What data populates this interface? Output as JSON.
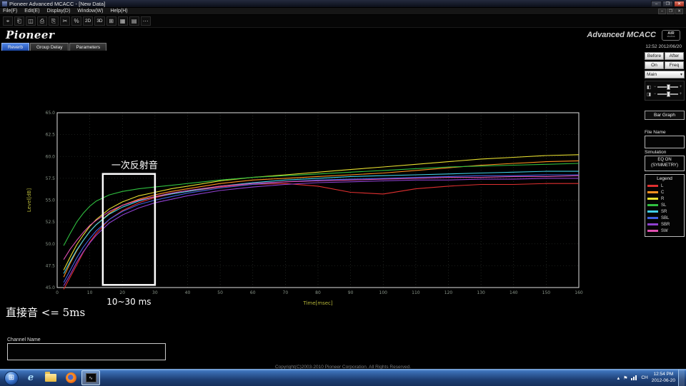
{
  "window": {
    "title": "Pioneer Advanced MCACC - [New Data]",
    "minimize": "–",
    "maximize": "❐",
    "close": "✕"
  },
  "menubar": {
    "items": [
      "File(F)",
      "Edit(E)",
      "Display(D)",
      "Window(W)",
      "Help(H)"
    ],
    "minimize": "–",
    "restore": "❐",
    "close": "✕"
  },
  "toolbar": {
    "items": [
      {
        "name": "select-icon",
        "glyph": "⌖"
      },
      {
        "name": "open-file-icon",
        "glyph": "⎗"
      },
      {
        "name": "save-icon",
        "glyph": "◫"
      },
      {
        "name": "print-icon",
        "glyph": "⎙"
      },
      {
        "name": "copy-icon",
        "glyph": "⎘"
      },
      {
        "name": "cut-icon",
        "glyph": "✂"
      },
      {
        "name": "percent-icon",
        "glyph": "%"
      },
      {
        "name": "view-2d-button",
        "label": "2D"
      },
      {
        "name": "view-3d-button",
        "label": "3D"
      },
      {
        "name": "grid-view-icon",
        "glyph": "⊞"
      },
      {
        "name": "table-view-icon",
        "glyph": "▦"
      },
      {
        "name": "list-view-icon",
        "glyph": "▤"
      },
      {
        "name": "more-tools-icon",
        "glyph": "⋯"
      }
    ]
  },
  "header": {
    "logo": "Pioneer",
    "product": "Advanced MCACC",
    "badge_top": "AIR",
    "badge_bottom": "studios"
  },
  "tabs": {
    "items": [
      {
        "id": "reverb",
        "label": "Reverb",
        "active": true
      },
      {
        "id": "group-delay",
        "label": "Group Delay",
        "active": false
      },
      {
        "id": "parameters",
        "label": "Parameters",
        "active": false
      }
    ],
    "timestamp": "12:52 2012/06/20"
  },
  "right_panel": {
    "before": "Before",
    "after": "After",
    "on": "On",
    "freq": "Freq",
    "channel_select": "Main",
    "bar_graph": "Bar Graph",
    "file_name_label": "File Name",
    "file_name_value": "",
    "simulation_label": "Simulation",
    "eq_line1": "EQ ON",
    "eq_line2": "(SYMMETRY)",
    "legend_title": "Legend",
    "legend_items": [
      {
        "label": "L",
        "color": "#e03030"
      },
      {
        "label": "C",
        "color": "#ff9020"
      },
      {
        "label": "R",
        "color": "#e8e030"
      },
      {
        "label": "SL",
        "color": "#30c040"
      },
      {
        "label": "SR",
        "color": "#40d0e8"
      },
      {
        "label": "SBL",
        "color": "#4060e0"
      },
      {
        "label": "SBR",
        "color": "#9040d0"
      },
      {
        "label": "SW",
        "color": "#e050b0"
      }
    ]
  },
  "annotations": {
    "first_reflection_label": "一次反射音",
    "range_label": "10~30 ms",
    "direct_sound_label": "直接音 <= 5ms",
    "box_ms": [
      14,
      30
    ],
    "box_db": [
      45.3,
      58.0
    ]
  },
  "chart_data": {
    "type": "line",
    "title": "Reverb characteristics (raw data)",
    "xlabel": "Time[msec]",
    "ylabel": "Level[dB]",
    "xlim": [
      0,
      160
    ],
    "ylim": [
      45,
      65
    ],
    "x_ticks": [
      0,
      10,
      20,
      30,
      40,
      50,
      60,
      70,
      80,
      90,
      100,
      110,
      120,
      130,
      140,
      150,
      160
    ],
    "y_ticks": [
      45.0,
      47.5,
      50.0,
      52.5,
      55.0,
      57.5,
      60.0,
      62.5,
      65.0
    ],
    "x": [
      2,
      4,
      6,
      8,
      10,
      12,
      16,
      20,
      25,
      30,
      35,
      40,
      50,
      60,
      70,
      80,
      90,
      100,
      110,
      120,
      130,
      140,
      150,
      160
    ],
    "series": [
      {
        "name": "L",
        "color": "#e03030",
        "values": [
          44.8,
          46.2,
          47.6,
          49.0,
          50.2,
          51.2,
          52.8,
          53.8,
          54.7,
          55.3,
          55.7,
          56.0,
          56.5,
          56.8,
          56.9,
          56.6,
          55.9,
          55.7,
          56.3,
          56.6,
          56.8,
          56.8,
          56.9,
          56.9
        ]
      },
      {
        "name": "C",
        "color": "#ff9020",
        "values": [
          46.2,
          47.8,
          49.2,
          50.4,
          51.4,
          52.2,
          53.5,
          54.4,
          55.1,
          55.6,
          56.0,
          56.3,
          56.9,
          57.3,
          57.5,
          57.7,
          57.9,
          58.1,
          58.4,
          58.7,
          59.0,
          59.2,
          59.4,
          59.5
        ]
      },
      {
        "name": "R",
        "color": "#e8e030",
        "values": [
          47.0,
          48.5,
          49.9,
          51.0,
          52.0,
          52.8,
          54.0,
          54.8,
          55.5,
          55.9,
          56.3,
          56.6,
          57.2,
          57.6,
          57.9,
          58.2,
          58.5,
          58.8,
          59.1,
          59.4,
          59.7,
          59.9,
          60.1,
          60.2
        ]
      },
      {
        "name": "SL",
        "color": "#30c040",
        "values": [
          49.8,
          51.2,
          52.5,
          53.5,
          54.3,
          54.9,
          55.6,
          56.0,
          56.3,
          56.5,
          56.7,
          56.9,
          57.3,
          57.6,
          57.8,
          58.0,
          58.2,
          58.4,
          58.6,
          58.8,
          58.9,
          59.0,
          59.1,
          59.2
        ]
      },
      {
        "name": "SR",
        "color": "#40d0e8",
        "values": [
          46.6,
          48.0,
          49.3,
          50.4,
          51.4,
          52.2,
          53.4,
          54.2,
          54.9,
          55.4,
          55.7,
          56.0,
          56.6,
          57.0,
          57.3,
          57.5,
          57.7,
          57.8,
          57.9,
          58.0,
          58.1,
          58.2,
          58.3,
          58.3
        ]
      },
      {
        "name": "SBL",
        "color": "#4060e0",
        "values": [
          45.6,
          47.0,
          48.4,
          49.6,
          50.6,
          51.5,
          52.8,
          53.7,
          54.5,
          55.0,
          55.4,
          55.8,
          56.4,
          56.8,
          57.1,
          57.3,
          57.4,
          57.5,
          57.6,
          57.7,
          57.8,
          57.8,
          57.9,
          57.9
        ]
      },
      {
        "name": "SBR",
        "color": "#9040d0",
        "values": [
          45.2,
          46.5,
          47.9,
          49.1,
          50.1,
          51.0,
          52.4,
          53.3,
          54.1,
          54.7,
          55.1,
          55.5,
          56.1,
          56.5,
          56.8,
          57.0,
          57.1,
          57.2,
          57.3,
          57.3,
          57.4,
          57.4,
          57.5,
          57.5
        ]
      },
      {
        "name": "SW",
        "color": "#e050b0",
        "values": [
          48.2,
          49.4,
          50.4,
          51.3,
          52.1,
          52.7,
          53.7,
          54.4,
          55.0,
          55.4,
          55.8,
          56.1,
          56.6,
          56.9,
          57.1,
          57.2,
          57.3,
          57.4,
          57.5,
          57.6,
          57.6,
          57.7,
          57.7,
          57.8
        ]
      }
    ],
    "grid": true,
    "legend_position": "right-panel"
  },
  "footer": {
    "channel_name_label": "Channel Name",
    "channel_name_value": "",
    "copyright": "Copyright(C)2003-2010 Pioneer Corporation. All Rights Reserved."
  },
  "taskbar": {
    "tray": {
      "chevron": "▴",
      "flag": "⚑",
      "language": "CH",
      "time": "12:54 PM",
      "date": "2012-06-20"
    }
  }
}
